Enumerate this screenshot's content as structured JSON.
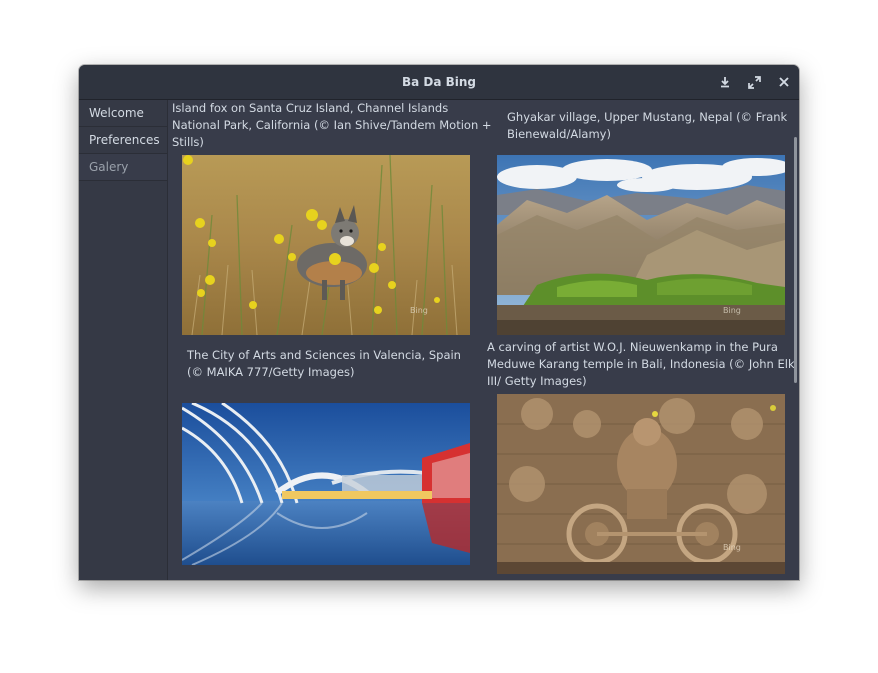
{
  "window": {
    "title": "Ba Da Bing"
  },
  "titlebar": {
    "buttons": [
      {
        "name": "download-icon"
      },
      {
        "name": "maximize-icon"
      },
      {
        "name": "close-icon"
      }
    ]
  },
  "sidebar": {
    "items": [
      {
        "label": "Welcome"
      },
      {
        "label": "Preferences"
      },
      {
        "label": "Galery",
        "selected": true
      }
    ]
  },
  "gallery": {
    "items": [
      {
        "caption": "Island fox on Santa Cruz Island, Channel Islands National Park, California (© Ian Shive/Tandem Motion + Stills)",
        "watermark": "Bing"
      },
      {
        "caption": "Ghyakar village, Upper Mustang, Nepal (© Frank Bienewald/Alamy)",
        "watermark": "Bing"
      },
      {
        "caption": "The City of Arts and Sciences in Valencia, Spain (© MAIKA 777/Getty Images)",
        "watermark": ""
      },
      {
        "caption": "A carving of artist W.O.J. Nieuwenkamp in the Pura Meduwe Karang temple in Bali, Indonesia (© John Elk III/ Getty Images)",
        "watermark": "Bing"
      }
    ]
  },
  "colors": {
    "window_bg": "#383c4a",
    "titlebar_bg": "#2f343f",
    "sidebar_bg": "#353945",
    "text": "#d3dae3"
  }
}
